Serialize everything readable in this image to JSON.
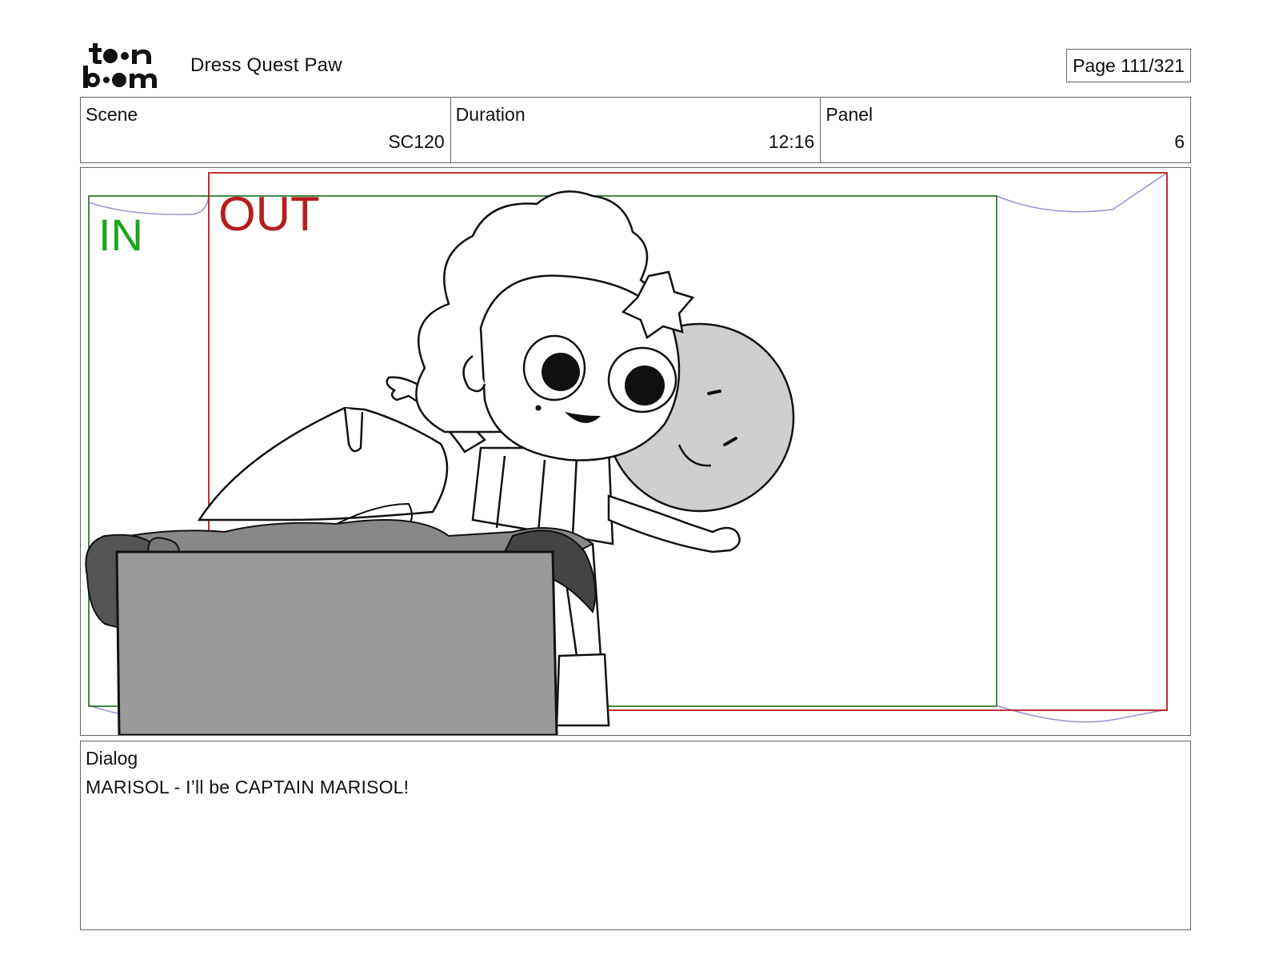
{
  "header": {
    "logo_text": "toonboom",
    "project_title": "Dress Quest Paw",
    "page_label": "Page 111/321"
  },
  "info": {
    "scene_label": "Scene",
    "scene_value": "SC120",
    "duration_label": "Duration",
    "duration_value": "12:16",
    "panel_label": "Panel",
    "panel_value": "6"
  },
  "panel": {
    "in_label": "IN",
    "out_label": "OUT",
    "colors": {
      "in_frame": "#2e7d32",
      "out_frame": "#b71c1c",
      "camera_path": "#9b8fd6"
    }
  },
  "dialog": {
    "label": "Dialog",
    "text": "MARISOL - I’ll be CAPTAIN MARISOL!"
  }
}
